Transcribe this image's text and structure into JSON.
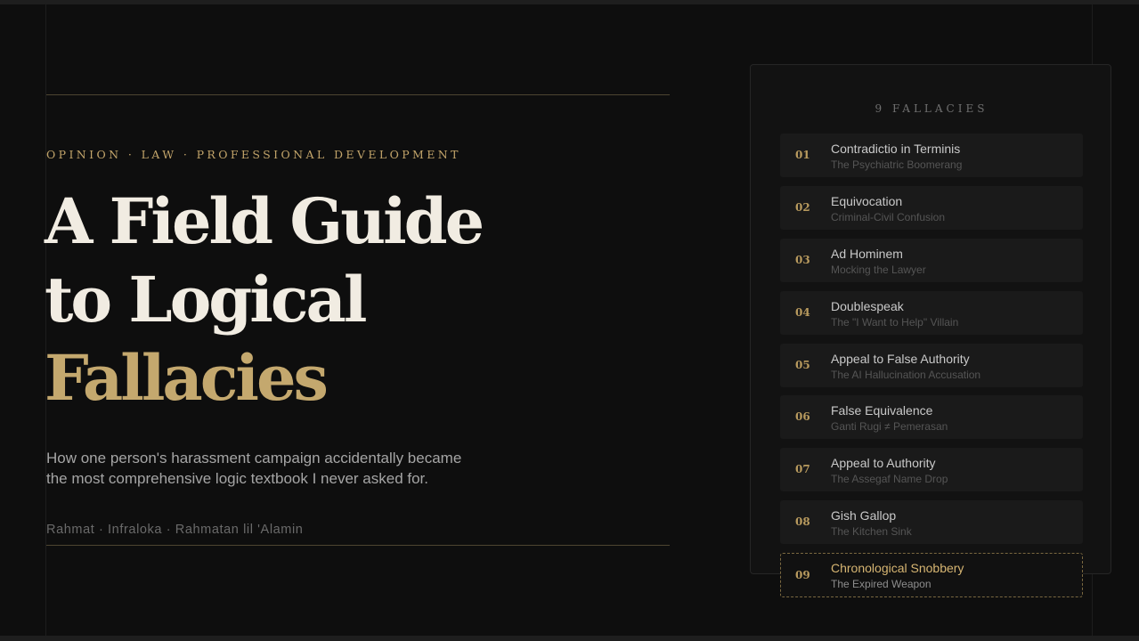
{
  "hero": {
    "kicker": "OPINION · LAW · PROFESSIONAL DEVELOPMENT",
    "title_line1": "A Field Guide",
    "title_line2": "to Logical",
    "title_line3": "Fallacies",
    "subtitle_line1": "How one person's harassment campaign accidentally became",
    "subtitle_line2": "the most comprehensive logic textbook I never asked for.",
    "byline": "Rahmat · Infraloka · Rahmatan lil 'Alamin"
  },
  "panel": {
    "heading": "9 FALLACIES",
    "items": [
      {
        "num": "01",
        "name": "Contradictio in Terminis",
        "desc": "The Psychiatric Boomerang"
      },
      {
        "num": "02",
        "name": "Equivocation",
        "desc": "Criminal-Civil Confusion"
      },
      {
        "num": "03",
        "name": "Ad Hominem",
        "desc": "Mocking the Lawyer"
      },
      {
        "num": "04",
        "name": "Doublespeak",
        "desc": "The \"I Want to Help\" Villain"
      },
      {
        "num": "05",
        "name": "Appeal to False Authority",
        "desc": "The AI Hallucination Accusation"
      },
      {
        "num": "06",
        "name": "False Equivalence",
        "desc": "Ganti Rugi ≠ Pemerasan"
      },
      {
        "num": "07",
        "name": "Appeal to Authority",
        "desc": "The Assegaf Name Drop"
      },
      {
        "num": "08",
        "name": "Gish Gallop",
        "desc": "The Kitchen Sink"
      },
      {
        "num": "09",
        "name": "Chronological Snobbery",
        "desc": "The Expired Weapon"
      }
    ]
  },
  "colors": {
    "background": "#0e0e0e",
    "accent_gold": "#c4a86e",
    "title_cream": "#f1ece2",
    "panel_bg": "#121212",
    "item_bg": "#1a1a1a"
  }
}
